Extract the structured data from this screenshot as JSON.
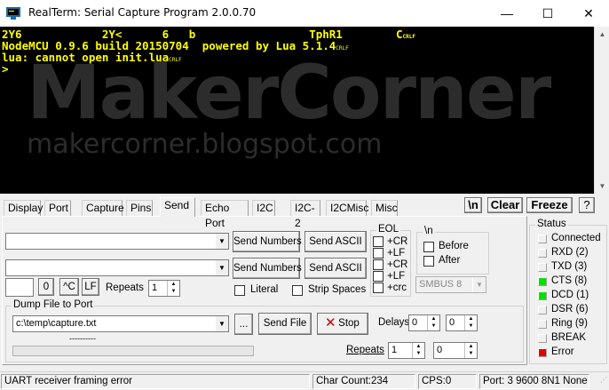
{
  "window": {
    "title": "RealTerm: Serial Capture Program 2.0.0.70",
    "minimize_glyph": "—",
    "maximize_glyph": "☐",
    "close_glyph": "✕"
  },
  "terminal": {
    "lines": [
      "2Y6            2Y<      6   b                 TphR1        C",
      "NodeMCU 0.9.6 build 20150704  powered by Lua 5.1.4",
      "lua: cannot open init.lua",
      ">"
    ],
    "crlf": "CRLF",
    "watermark_big": "MakerCorner",
    "watermark_small": "makercorner.blogspot.com",
    "text_color": "#ffff00",
    "background": "#000000"
  },
  "tabs": [
    "Display",
    "Port",
    "Capture",
    "Pins",
    "Send",
    "Echo Port",
    "I2C",
    "I2C-2",
    "I2CMisc",
    "Misc"
  ],
  "active_tab": "Send",
  "toolbar": {
    "newline_label": "\\n",
    "clear_label": "Clear",
    "freeze_label": "Freeze",
    "help_label": "?"
  },
  "send": {
    "combo1_value": "",
    "combo2_value": "",
    "send_numbers_1": "Send Numbers",
    "send_ascii_1": "Send ASCII",
    "send_numbers_2": "Send Numbers",
    "send_ascii_2": "Send ASCII",
    "small_input_value": "",
    "zero_label": "0",
    "ctrl_c_label": "^C",
    "lf_label": "LF",
    "repeats_label": "Repeats",
    "repeats_value": "1",
    "literal_label": "Literal",
    "strip_spaces_label": "Strip Spaces",
    "eol_title": "EOL",
    "eol_options": [
      "+CR",
      "+LF",
      "+CR",
      "+LF",
      "+crc"
    ],
    "nl_title": "\\n",
    "before_label": "Before",
    "after_label": "After",
    "smbus_value": "SMBUS 8"
  },
  "dump": {
    "title": "Dump File to Port",
    "file_path": "c:\\temp\\capture.txt",
    "browse_label": "...",
    "send_file_label": "Send File",
    "stop_label": "Stop",
    "delays_label": "Delays",
    "delay1": "0",
    "delay2": "0",
    "progress_text": "----------",
    "repeats_label": "Repeats",
    "repeats1": "1",
    "repeats2": "0"
  },
  "status": {
    "title": "Status",
    "signals": [
      {
        "label": "Connected",
        "color": "#f0f0f0"
      },
      {
        "label": "RXD (2)",
        "color": "#f0f0f0"
      },
      {
        "label": "TXD (3)",
        "color": "#f0f0f0"
      },
      {
        "label": "CTS (8)",
        "color": "#00e000"
      },
      {
        "label": "DCD (1)",
        "color": "#00e000"
      },
      {
        "label": "DSR (6)",
        "color": "#f0f0f0"
      },
      {
        "label": "Ring (9)",
        "color": "#f0f0f0"
      },
      {
        "label": "BREAK",
        "color": "#f0f0f0"
      },
      {
        "label": "Error",
        "color": "#e00000"
      }
    ]
  },
  "statusbar": {
    "message": "UART receiver framing error",
    "char_count": "Char Count:234",
    "cps": "CPS:0",
    "port": "Port: 3 9600 8N1 None"
  }
}
